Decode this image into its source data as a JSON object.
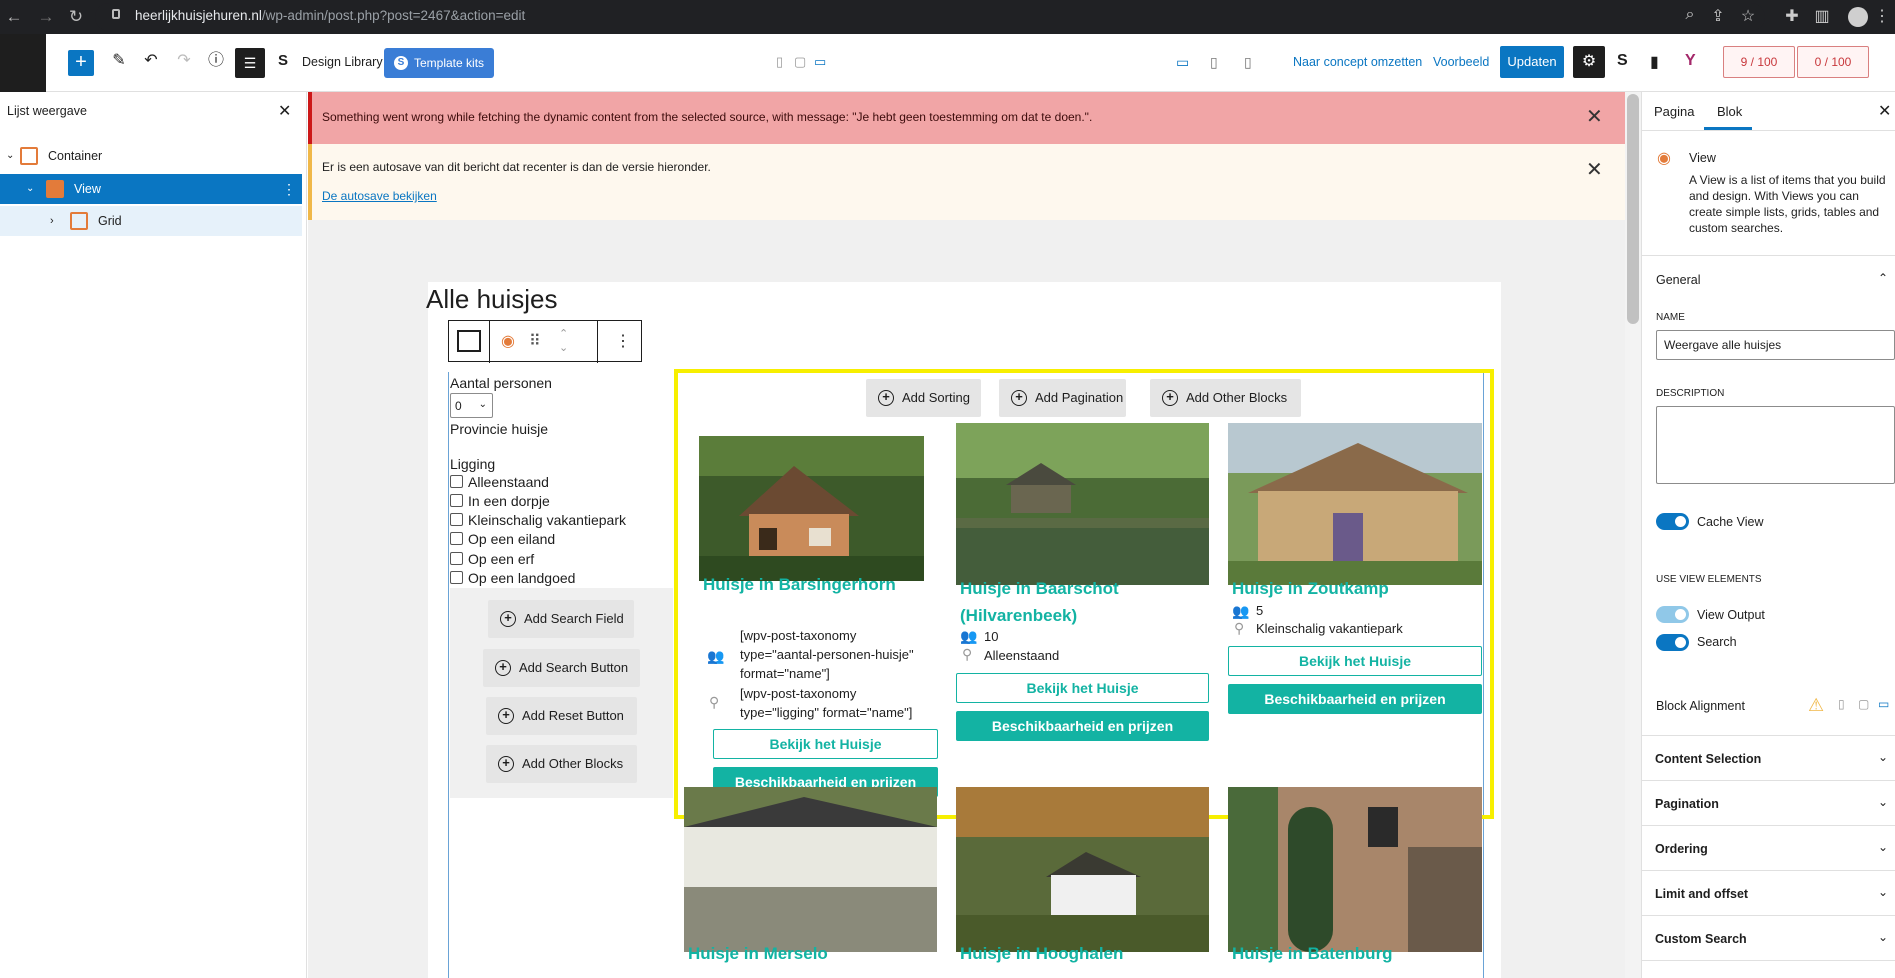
{
  "browser": {
    "url_domain": "heerlijkhuisjehuren.nl",
    "url_path": "/wp-admin/post.php?post=2467&action=edit"
  },
  "toolbar": {
    "design_library": "Design Library",
    "template_kits": "Template kits",
    "switch_draft": "Naar concept omzetten",
    "preview": "Voorbeeld",
    "update": "Updaten",
    "seo_score": "9 / 100",
    "readability_score": "0 / 100"
  },
  "list_view": {
    "title": "Lijst weergave",
    "items": [
      {
        "label": "Container"
      },
      {
        "label": "View"
      },
      {
        "label": "Grid"
      }
    ]
  },
  "notices": {
    "error": "Something went wrong while fetching the dynamic content from the selected source, with message: \"Je hebt geen toestemming om dat te doen.\".",
    "autosave": "Er is een autosave van dit bericht dat recenter is dan de versie hieronder.",
    "autosave_link": "De autosave bekijken"
  },
  "page": {
    "title": "Alle huisjes"
  },
  "search": {
    "persons_label": "Aantal personen",
    "persons_value": "0",
    "province_label": "Provincie huisje",
    "location_label": "Ligging",
    "options": [
      "Alleenstaand",
      "In een dorpje",
      "Kleinschalig vakantiepark",
      "Op een eiland",
      "Op een erf",
      "Op een landgoed"
    ],
    "add_search_field": "Add Search Field",
    "add_search_button": "Add Search Button",
    "add_reset_button": "Add Reset Button",
    "add_other_blocks": "Add Other Blocks"
  },
  "grid_toolbar": {
    "add_sorting": "Add Sorting",
    "add_pagination": "Add Pagination",
    "add_other_blocks": "Add Other Blocks"
  },
  "cards": [
    {
      "title": "Huisje in Barsingerhorn",
      "persons": "[wpv-post-taxonomy type=\"aantal-personen-huisje\" format=\"name\"]",
      "location": "[wpv-post-taxonomy type=\"ligging\" format=\"name\"]",
      "btn1": "Bekijk het Huisje",
      "btn2": "Beschikbaarheid en prijzen"
    },
    {
      "title": "Huisje in Baarschot (Hilvarenbeek)",
      "persons": "10",
      "location": "Alleenstaand",
      "btn1": "Bekijk het Huisje",
      "btn2": "Beschikbaarheid en prijzen"
    },
    {
      "title": "Huisje in Zoutkamp",
      "persons": "5",
      "location": "Kleinschalig vakantiepark",
      "btn1": "Bekijk het Huisje",
      "btn2": "Beschikbaarheid en prijzen"
    },
    {
      "title": "Huisje in Merselo"
    },
    {
      "title": "Huisje in Hooghalen"
    },
    {
      "title": "Huisje in Batenburg"
    }
  ],
  "sidebar": {
    "tab_page": "Pagina",
    "tab_block": "Blok",
    "block_name": "View",
    "block_desc": "A View is a list of items that you build and design. With Views you can create simple lists, grids, tables and custom searches.",
    "general": "General",
    "name_label": "NAME",
    "name_value": "Weergave alle huisjes",
    "description_label": "DESCRIPTION",
    "cache_view": "Cache View",
    "use_view_elements": "USE VIEW ELEMENTS",
    "view_output": "View Output",
    "search": "Search",
    "block_alignment": "Block Alignment",
    "sections": [
      "Content Selection",
      "Pagination",
      "Ordering",
      "Limit and offset",
      "Custom Search"
    ]
  }
}
